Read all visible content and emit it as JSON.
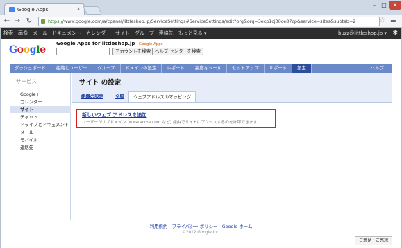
{
  "browser": {
    "tab_title": "Google Apps",
    "tab_close": "×",
    "minimize": "–",
    "maximize": "□",
    "close": "✕",
    "back": "←",
    "forward": "→",
    "reload": "↻",
    "url_scheme": "https",
    "url_rest": "://www.google.com/a/cpanel/littleshop.jp/ServiceSettings#ServiceSettings/edit?org&org=3ecp1cj30ce87cp&service=sites&subtab=2",
    "star": "☆",
    "wrench": "🔧"
  },
  "gbar": {
    "links": [
      "検索",
      "画像",
      "メール",
      "ドキュメント",
      "カレンダー",
      "サイト",
      "グループ",
      "連絡先",
      "もっと見る ▾"
    ],
    "user": "buzz@littleshop.jp ▾",
    "gear": "✱"
  },
  "header": {
    "logo_letters": [
      {
        "ch": "G",
        "color": "#3369e8"
      },
      {
        "ch": "o",
        "color": "#d50f25"
      },
      {
        "ch": "o",
        "color": "#eeb211"
      },
      {
        "ch": "g",
        "color": "#3369e8"
      },
      {
        "ch": "l",
        "color": "#009925"
      },
      {
        "ch": "e",
        "color": "#d50f25"
      }
    ],
    "title": "Google Apps for littleshop.jp",
    "title_suffix": " - Google Apps",
    "search_button": "アカウントを検索",
    "help_button": "ヘルプ センターを検索"
  },
  "nav_tabs": [
    {
      "label": "ダッシュボード",
      "active": false
    },
    {
      "label": "組織とユーザー",
      "active": false
    },
    {
      "label": "グループ",
      "active": false
    },
    {
      "label": "ドメインの設定",
      "active": false
    },
    {
      "label": "レポート",
      "active": false
    },
    {
      "label": "高度なツール",
      "active": false
    },
    {
      "label": "セットアップ",
      "active": false
    },
    {
      "label": "サポート",
      "active": false
    },
    {
      "label": "設定",
      "active": true
    }
  ],
  "nav_help": "ヘルプ",
  "sidebar": {
    "heading": "サービス",
    "items": [
      {
        "label": "Google+",
        "selected": false
      },
      {
        "label": "カレンダー",
        "selected": false
      },
      {
        "label": "サイト",
        "selected": true
      },
      {
        "label": "チャット",
        "selected": false
      },
      {
        "label": "ドライブとドキュメント",
        "selected": false
      },
      {
        "label": "メール",
        "selected": false
      },
      {
        "label": "モバイル",
        "selected": false
      },
      {
        "label": "連絡先",
        "selected": false
      }
    ]
  },
  "main": {
    "title": "サイト の設定",
    "subtabs": [
      {
        "label": "組織の設定",
        "active": false
      },
      {
        "label": "全般",
        "active": false
      },
      {
        "label": "ウェブアドレスのマッピング",
        "active": true
      }
    ],
    "add_link": "新しいウェブ アドレスを追加",
    "add_desc": "ユーザーがサブドメイン (www.acme.com など) 経由でサイトにアクセスするのを許可できます",
    "highlight_color": "#d32020"
  },
  "footer": {
    "links": [
      "利用規約",
      "プライバシー ポリシー",
      "Google ホーム"
    ],
    "separator": " - ",
    "copyright": "©2012 Google Inc.",
    "feedback": "ご意見・ご感想"
  }
}
